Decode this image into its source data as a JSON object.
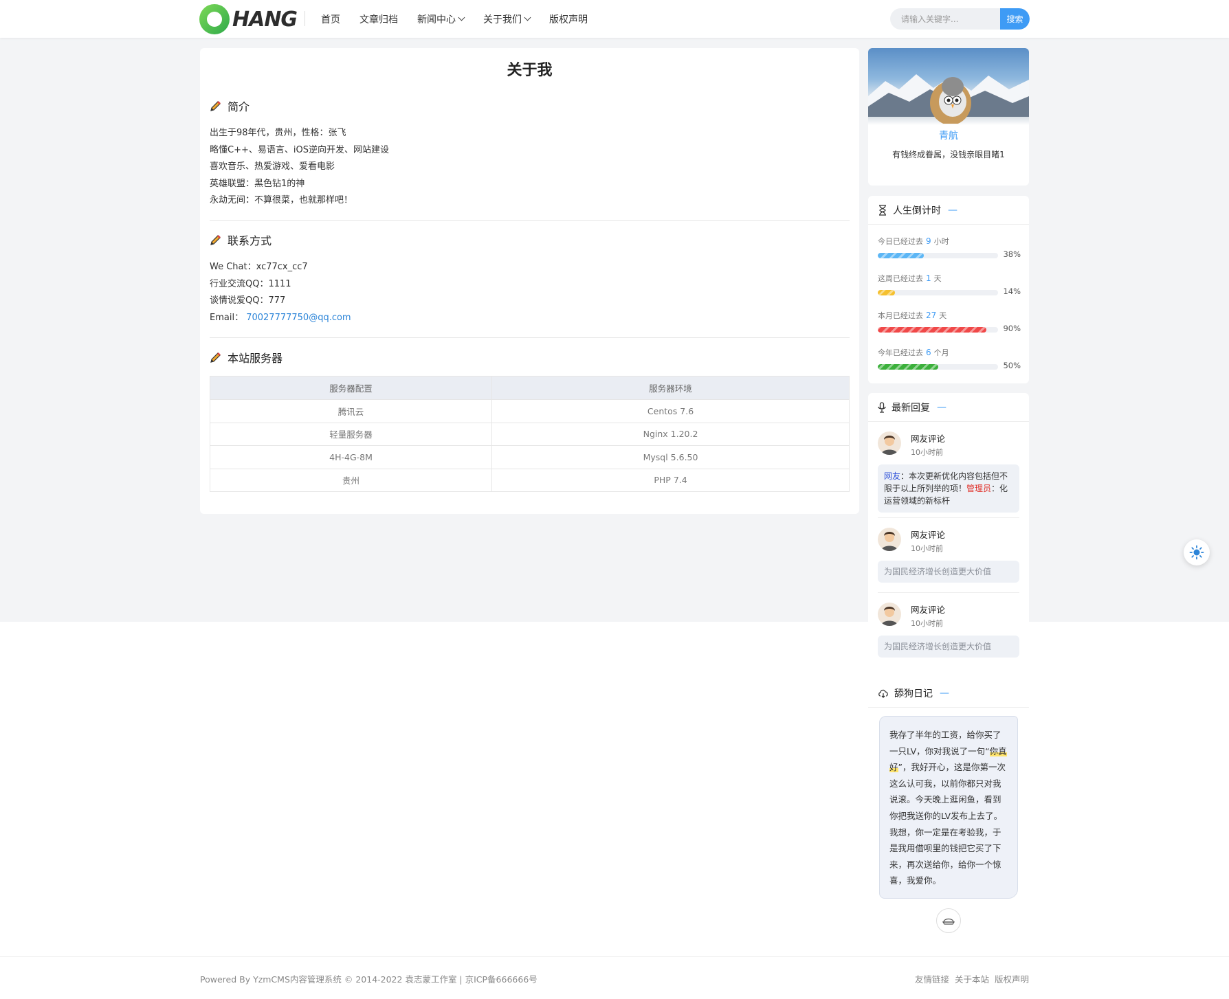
{
  "header": {
    "logo_text": "HANG",
    "nav": [
      {
        "label": "首页"
      },
      {
        "label": "文章归档"
      },
      {
        "label": "新闻中心",
        "dropdown": true
      },
      {
        "label": "关于我们",
        "dropdown": true
      },
      {
        "label": "版权声明"
      }
    ],
    "search_placeholder": "请输入关键字...",
    "search_button": "搜索"
  },
  "main": {
    "title": "关于我",
    "intro": {
      "heading": "简介",
      "lines": [
        "出生于98年代，贵州，性格：张飞",
        "略懂C++、易语言、iOS逆向开发、网站建设",
        "喜欢音乐、热爱游戏、爱看电影",
        "英雄联盟：黑色钻1的神",
        "永劫无间：不算很菜，也就那样吧！"
      ]
    },
    "contact": {
      "heading": "联系方式",
      "wechat": "We Chat：xc77cx_cc7",
      "qq_industry": "行业交流QQ：1111",
      "qq_love": "谈情说爱QQ：777",
      "email_label": "Email：",
      "email": "70027777750@qq.com"
    },
    "server": {
      "heading": "本站服务器",
      "columns": [
        "服务器配置",
        "服务器环境"
      ],
      "rows": [
        [
          "腾讯云",
          "Centos 7.6"
        ],
        [
          "轻量服务器",
          "Nginx 1.20.2"
        ],
        [
          "4H-4G-8M",
          "Mysql 5.6.50"
        ],
        [
          "贵州",
          "PHP 7.4"
        ]
      ]
    }
  },
  "sidebar": {
    "profile": {
      "name": "青航",
      "motto": "有钱终成眷属，没钱亲眼目睹1"
    },
    "countdown": {
      "title": "人生倒计时",
      "dash": "—",
      "items": [
        {
          "prefix": "今日已经过去",
          "value": "9",
          "unit": "小时",
          "percent": "38%",
          "fraction": 0.38,
          "color": "#5cb6f5"
        },
        {
          "prefix": "这周已经过去",
          "value": "1",
          "unit": "天",
          "percent": "14%",
          "fraction": 0.14,
          "color": "#f5c02e"
        },
        {
          "prefix": "本月已经过去",
          "value": "27",
          "unit": "天",
          "percent": "90%",
          "fraction": 0.9,
          "color": "#f04848"
        },
        {
          "prefix": "今年已经过去",
          "value": "6",
          "unit": "个月",
          "percent": "50%",
          "fraction": 0.5,
          "color": "#3bb03b"
        }
      ]
    },
    "replies": {
      "title": "最新回复",
      "dash": "—",
      "items": [
        {
          "name": "网友评论",
          "time": "10小时前",
          "user_tag": "网友",
          "user_text": "：本次更新优化内容包括但不限于以上所列举的项！",
          "admin_tag": "管理员",
          "admin_text": "：化运营领域的新标杆"
        },
        {
          "name": "网友评论",
          "time": "10小时前",
          "text": "为国民经济增长创造更大价值"
        },
        {
          "name": "网友评论",
          "time": "10小时前",
          "text": "为国民经济增长创造更大价值"
        }
      ]
    },
    "diary": {
      "title": "舔狗日记",
      "dash": "—",
      "text_before": "我存了半年的工资，给你买了一只LV，你对我说了一句“",
      "highlight": "你真好",
      "text_after": "”，我好开心，这是你第一次这么认可我，以前你都只对我说滚。今天晚上逛闲鱼，看到你把我送你的LV发布上去了。我想，你一定是在考验我，于是我用借呗里的钱把它买了下来，再次送给你，给你一个惊喜，我爱你。"
    }
  },
  "footer": {
    "left": "Powered By YzmCMS内容管理系统 © 2014-2022 袁志蒙工作室 |  京ICP备666666号",
    "links": [
      "友情链接",
      "关于本站",
      "版权声明"
    ]
  }
}
